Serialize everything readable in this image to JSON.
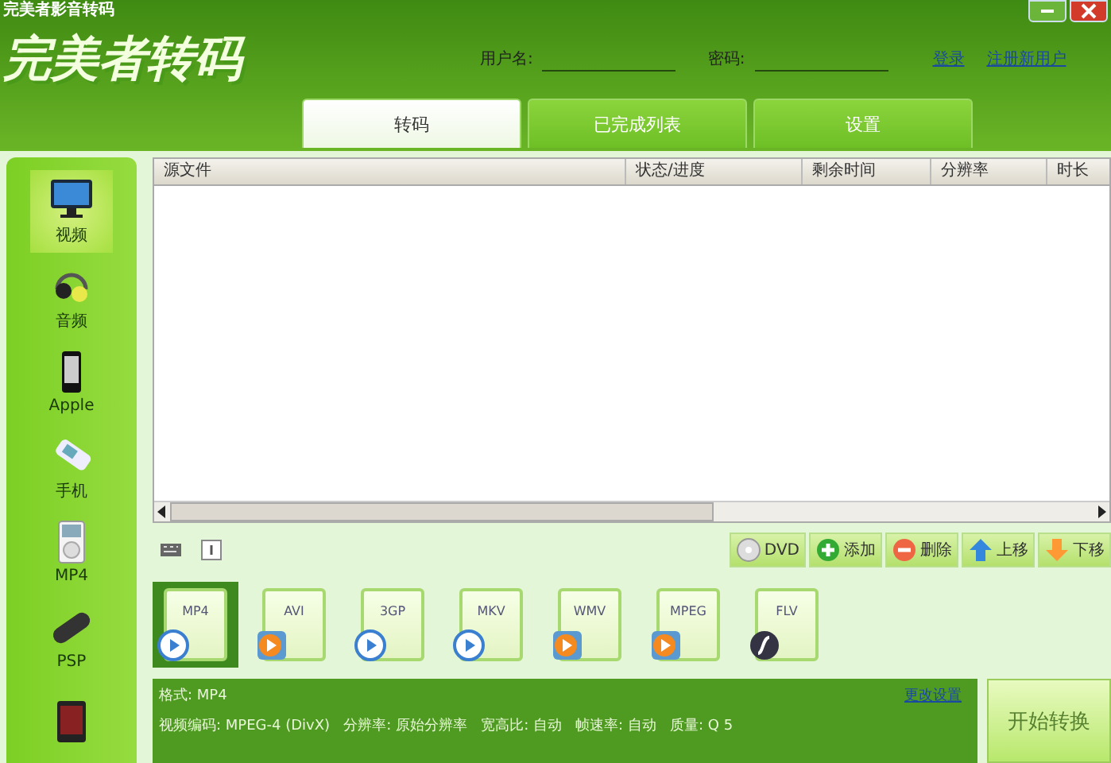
{
  "window": {
    "title": "完美者影音转码"
  },
  "logo": "完美者转码",
  "login": {
    "username_label": "用户名:",
    "password_label": "密码:",
    "login_link": "登录",
    "register_link": "注册新用户"
  },
  "tabs": [
    {
      "label": "转码",
      "selected": true
    },
    {
      "label": "已完成列表",
      "selected": false
    },
    {
      "label": "设置",
      "selected": false
    }
  ],
  "sidebar": {
    "items": [
      {
        "label": "视频",
        "kind": "monitor",
        "selected": true
      },
      {
        "label": "音频",
        "kind": "headphones",
        "selected": false
      },
      {
        "label": "Apple",
        "kind": "phone",
        "selected": false
      },
      {
        "label": "手机",
        "kind": "handset",
        "selected": false
      },
      {
        "label": "MP4",
        "kind": "player",
        "selected": false
      },
      {
        "label": "PSP",
        "kind": "console",
        "selected": false
      },
      {
        "kind": "device",
        "selected": false
      }
    ]
  },
  "table": {
    "columns": [
      "源文件",
      "状态/进度",
      "剩余时间",
      "分辨率",
      "时长"
    ]
  },
  "toolbar": {
    "buttons": [
      {
        "label": "DVD",
        "kind": "disc"
      },
      {
        "label": "添加",
        "kind": "add"
      },
      {
        "label": "删除",
        "kind": "remove"
      },
      {
        "label": "上移",
        "kind": "up"
      },
      {
        "label": "下移",
        "kind": "down"
      }
    ]
  },
  "formats": [
    {
      "label": "MP4",
      "kind": "blue",
      "selected": true
    },
    {
      "label": "AVI",
      "kind": "orange",
      "selected": false
    },
    {
      "label": "3GP",
      "kind": "blue",
      "selected": false
    },
    {
      "label": "MKV",
      "kind": "blue",
      "selected": false
    },
    {
      "label": "WMV",
      "kind": "orange",
      "selected": false
    },
    {
      "label": "MPEG",
      "kind": "orange",
      "selected": false
    },
    {
      "label": "FLV",
      "kind": "flash",
      "selected": false
    }
  ],
  "info": {
    "format": "格式: MP4",
    "change_link": "更改设置",
    "details": "视频编码: MPEG-4 (DivX)   分辨率: 原始分辨率   宽高比: 自动   帧速率: 自动   质量: Q 5"
  },
  "start_button": "开始转换"
}
